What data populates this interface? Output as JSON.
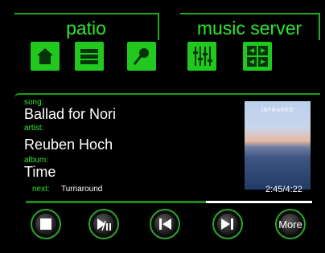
{
  "header": {
    "zone_tab": "patio",
    "server_tab": "music server"
  },
  "toolbar": [
    {
      "icon": "home-icon"
    },
    {
      "icon": "list-icon"
    },
    {
      "icon": "search-icon"
    },
    {
      "icon": "equalizer-icon"
    },
    {
      "icon": "grid-icon"
    }
  ],
  "now_playing": {
    "song_label": "song:",
    "song": "Ballad for Nori",
    "artist_label": "artist:",
    "artist": "Reuben Hoch",
    "album_label": "album:",
    "album": "Time",
    "next_label": "next:",
    "next": "Turnaround",
    "album_art_text": "INFRARED",
    "time": "2:45/4:22",
    "progress": 0.63
  },
  "controls": {
    "stop": "stop-icon",
    "play_pause": "play-pause-icon",
    "previous": "previous-track-icon",
    "next": "next-track-icon",
    "more_label": "More"
  },
  "colors": {
    "accent": "#2ee52a",
    "background": "#000000"
  }
}
